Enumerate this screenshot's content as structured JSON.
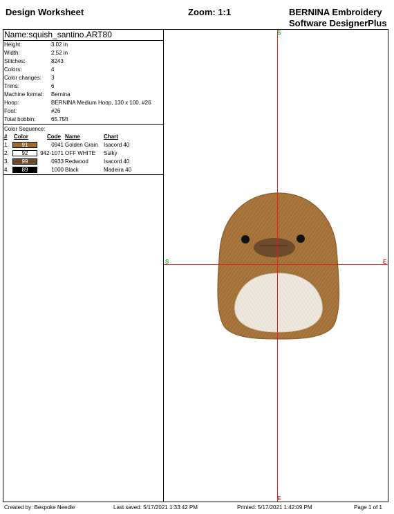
{
  "header": {
    "title": "Design Worksheet",
    "zoom": "Zoom:   1:1",
    "brand_line1": "BERNINA Embroidery",
    "brand_line2": "Software DesignerPlus"
  },
  "design": {
    "name": "Name:squish_santino.ART80",
    "info": [
      {
        "label": "Height:",
        "value": "3.02 in"
      },
      {
        "label": "Width:",
        "value": "2.52 in"
      },
      {
        "label": "Stitches:",
        "value": "8243"
      },
      {
        "label": "Colors:",
        "value": "4"
      },
      {
        "label": "Color changes:",
        "value": "3"
      },
      {
        "label": "Trims:",
        "value": "6"
      },
      {
        "label": "Machine format:",
        "value": "Bernina"
      },
      {
        "label": "Hoop:",
        "value": "BERNINA Medium Hoop, 130 x 100, #26"
      },
      {
        "label": "Foot:",
        "value": "#26"
      },
      {
        "label": "Total bobbin:",
        "value": "65.75ft"
      }
    ]
  },
  "color_sequence": {
    "title": "Color Sequence:",
    "headers": {
      "num": "#",
      "color": "Color",
      "code": "Code",
      "name": "Name",
      "chart": "Chart"
    },
    "rows": [
      {
        "num": "1.",
        "swatch": "91",
        "swatch_color": "#9a6a2c",
        "swatch_text_color": "#ffffff",
        "code": "0941",
        "name": "Golden Grain",
        "chart": "Isacord 40"
      },
      {
        "num": "2.",
        "swatch": "92",
        "swatch_color": "#ffffff",
        "swatch_text_color": "#000000",
        "code": "942-1071",
        "name": "OFF WHITE",
        "chart": "Sulky"
      },
      {
        "num": "3.",
        "swatch": "99",
        "swatch_color": "#6e4a2c",
        "swatch_text_color": "#ffffff",
        "code": "0933",
        "name": "Redwood",
        "chart": "Isacord 40"
      },
      {
        "num": "4.",
        "swatch": "89",
        "swatch_color": "#000000",
        "swatch_text_color": "#ffffff",
        "code": "1000",
        "name": "Black",
        "chart": "Madeira 40"
      }
    ]
  },
  "markers": {
    "start": "S",
    "end": "E"
  },
  "footer": {
    "created_by": "Created by: Bespoke Needle",
    "last_saved": "Last saved: 5/17/2021 1:33:42 PM",
    "printed": "Printed: 5/17/2021 1:42:09 PM",
    "page": "Page 1 of 1"
  },
  "colors": {
    "axis": "#e02020",
    "marker_start": "#2aa02a",
    "body": "#a9773e",
    "belly": "#efe8dd",
    "snout": "#6e4a2c"
  }
}
